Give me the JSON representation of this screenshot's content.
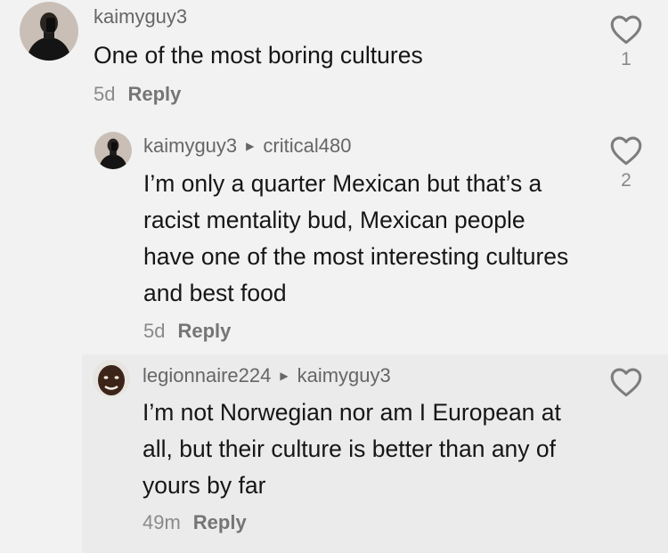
{
  "comments": [
    {
      "username": "kaimyguy3",
      "reply_to": "",
      "text": "One of the most boring cultures",
      "time": "5d",
      "reply_label": "Reply",
      "likes": "1",
      "avatar_icon": "person-photo-avatar"
    },
    {
      "username": "kaimyguy3",
      "reply_to": "critical480",
      "text": "I’m only a quarter Mexican but that’s a racist mentality bud, Mexican people have one of the most interesting cultures and best food",
      "time": "5d",
      "reply_label": "Reply",
      "likes": "2",
      "avatar_icon": "person-photo-avatar"
    },
    {
      "username": "legionnaire224",
      "reply_to": "kaimyguy3",
      "text": "I’m not Norwegian nor am I European at all, but their culture is better than any of yours by far",
      "time": "49m",
      "reply_label": "Reply",
      "likes": "",
      "avatar_icon": "face-photo-avatar"
    }
  ],
  "colors": {
    "background": "#f2f2f2",
    "highlight": "#ebebeb",
    "text": "#161616",
    "muted": "#8a8a8a"
  }
}
